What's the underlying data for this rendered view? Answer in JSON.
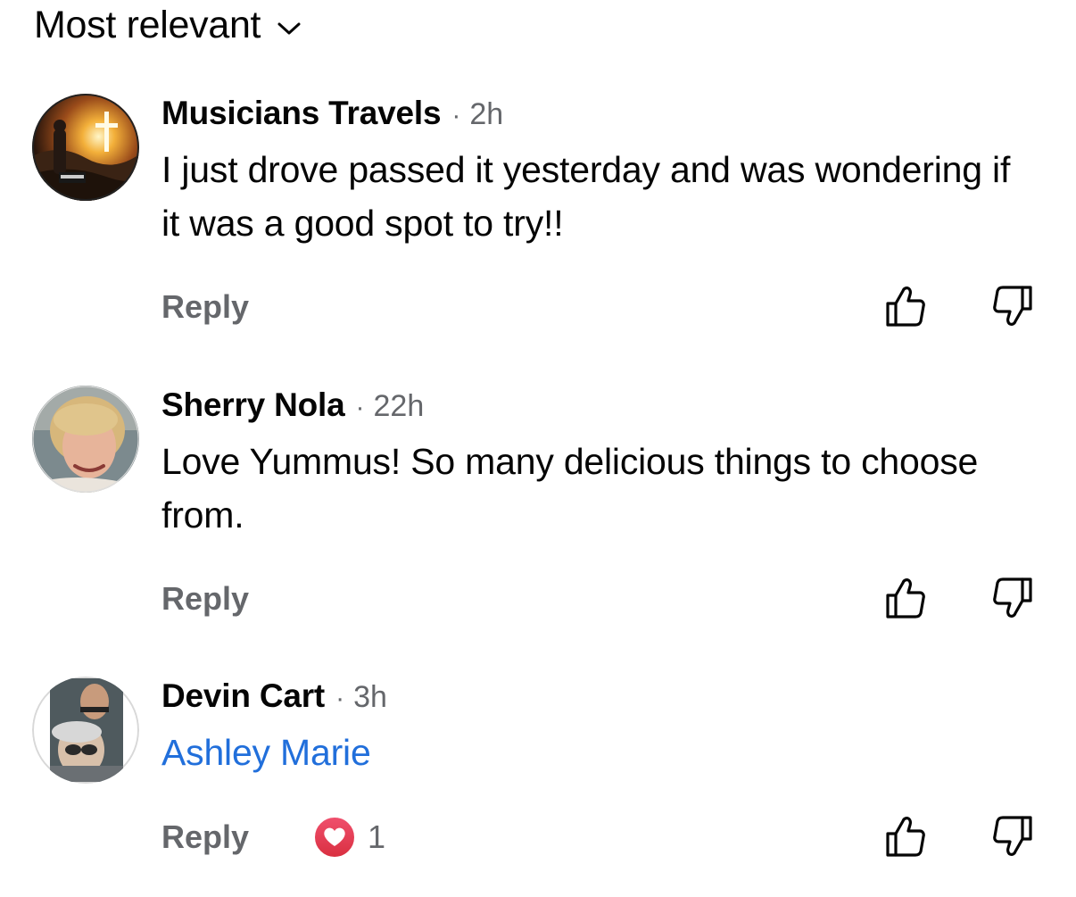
{
  "header": {
    "sort_label": "Most relevant",
    "chevron_icon": "chevron-down-icon"
  },
  "colors": {
    "secondary_text": "#65676b",
    "mention_link": "#216fdb",
    "heart_reaction": "#e8434f"
  },
  "comments": [
    {
      "author": "Musicians Travels",
      "separator": "·",
      "time": "2h",
      "text": "I just drove passed it yesterday and was wondering if it was a good spot to try!!",
      "reply_label": "Reply",
      "like_icon": "thumbs-up-icon",
      "dislike_icon": "thumbs-down-icon"
    },
    {
      "author": "Sherry Nola",
      "separator": "·",
      "time": "22h",
      "text": "Love Yummus!  So many delicious things to choose from.",
      "reply_label": "Reply",
      "like_icon": "thumbs-up-icon",
      "dislike_icon": "thumbs-down-icon"
    },
    {
      "author": "Devin Cart",
      "separator": "·",
      "time": "3h",
      "mention": "Ashley Marie",
      "reply_label": "Reply",
      "reaction_icon": "heart-icon",
      "reaction_count": "1",
      "like_icon": "thumbs-up-icon",
      "dislike_icon": "thumbs-down-icon"
    }
  ]
}
